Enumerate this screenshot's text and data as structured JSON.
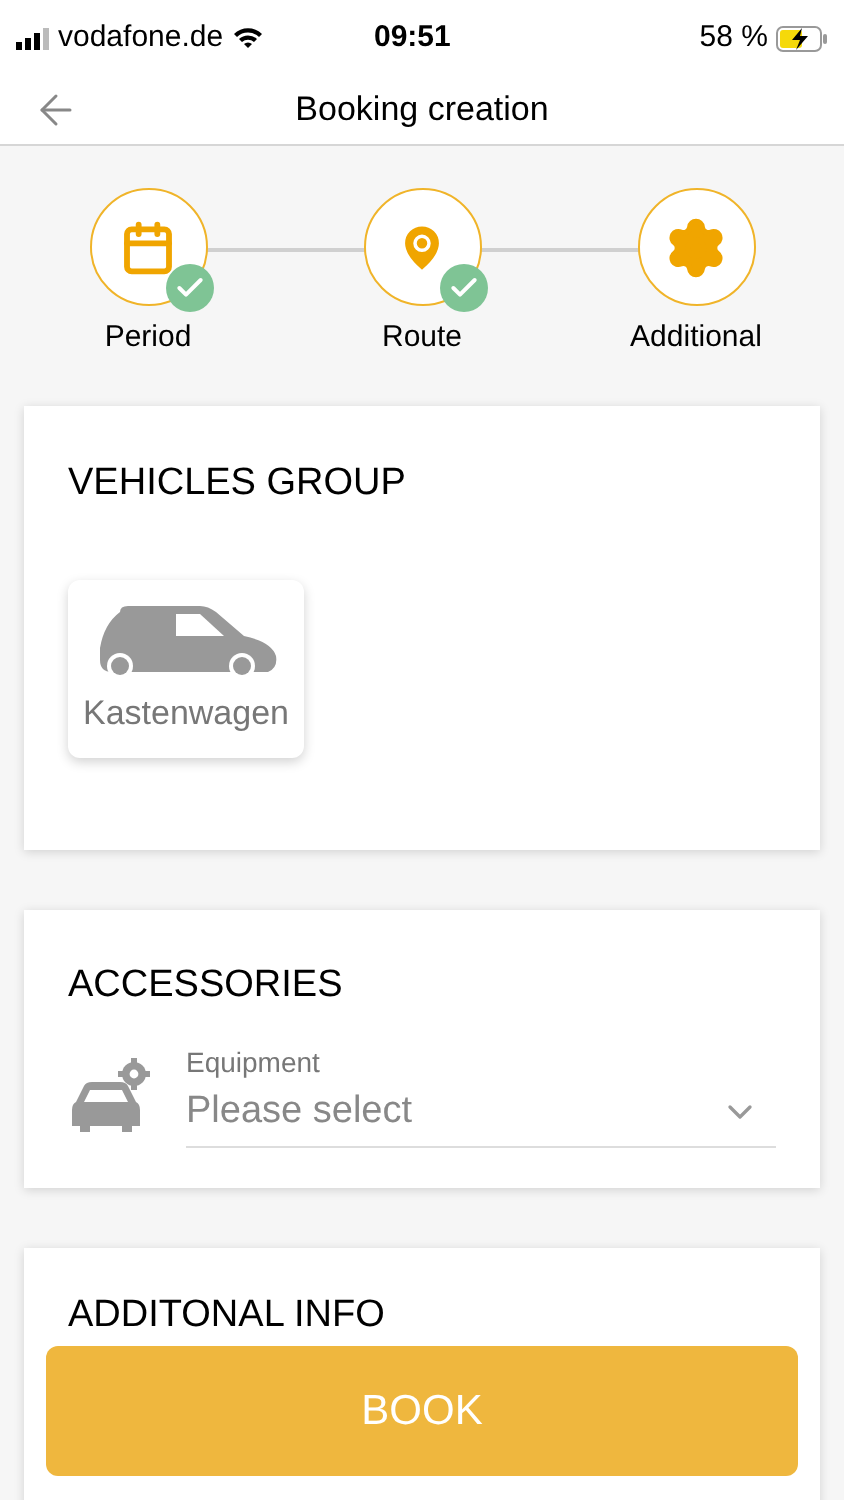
{
  "status_bar": {
    "carrier": "vodafone.de",
    "time": "09:51",
    "battery": "58 %"
  },
  "header": {
    "title": "Booking creation"
  },
  "steps": [
    {
      "label": "Period",
      "kind": "calendar",
      "completed": true
    },
    {
      "label": "Route",
      "kind": "pin",
      "completed": true
    },
    {
      "label": "Additional",
      "kind": "gear",
      "completed": false
    }
  ],
  "vehicles_group": {
    "title": "VEHICLES GROUP",
    "vehicles": [
      {
        "label": "Kastenwagen"
      }
    ]
  },
  "accessories": {
    "title": "ACCESSORIES",
    "field": {
      "label": "Equipment",
      "placeholder": "Please select"
    }
  },
  "additional_info": {
    "title": "ADDITONAL INFO"
  },
  "book_button": "BOOK"
}
